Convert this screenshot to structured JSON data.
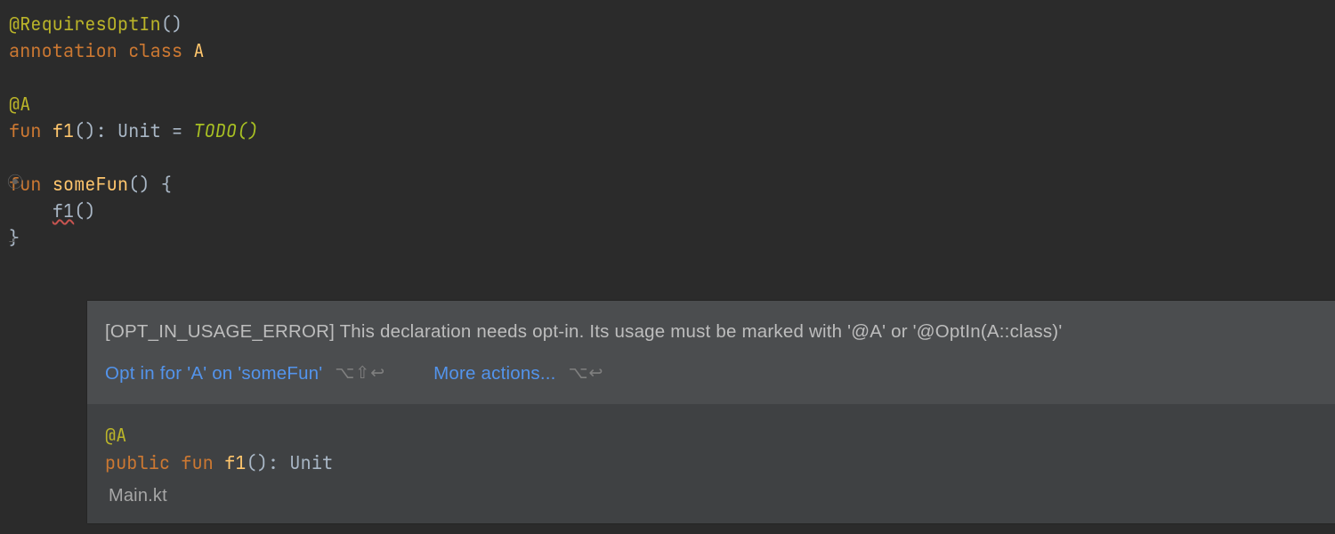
{
  "code": {
    "l1_ann": "@RequiresOptIn",
    "l1_paren": "()",
    "l2_kw1": "annotation ",
    "l2_kw2": "class ",
    "l2_id": "A",
    "l4_ann": "@A",
    "l5_kw": "fun ",
    "l5_id": "f1",
    "l5_after": "(): Unit = ",
    "l5_todo": "TODO()",
    "l7_kw": "fun ",
    "l7_id": "someFun",
    "l7_after": "() {",
    "l8_indent": "    ",
    "l8_call": "f1",
    "l8_paren": "()",
    "l9_brace": "}"
  },
  "popup": {
    "error_msg": "[OPT_IN_USAGE_ERROR] This declaration needs opt-in. Its usage must be marked with '@A' or '@OptIn(A::class)'",
    "quickfix_label": "Opt in for 'A' on 'someFun'",
    "quickfix_shortcut": "⌥⇧↩",
    "more_label": "More actions...",
    "more_shortcut": "⌥↩",
    "doc_ann": "@A",
    "doc_kw1": "public ",
    "doc_kw2": "fun ",
    "doc_id": "f1",
    "doc_sig": "(): Unit",
    "file": "Main.kt"
  }
}
